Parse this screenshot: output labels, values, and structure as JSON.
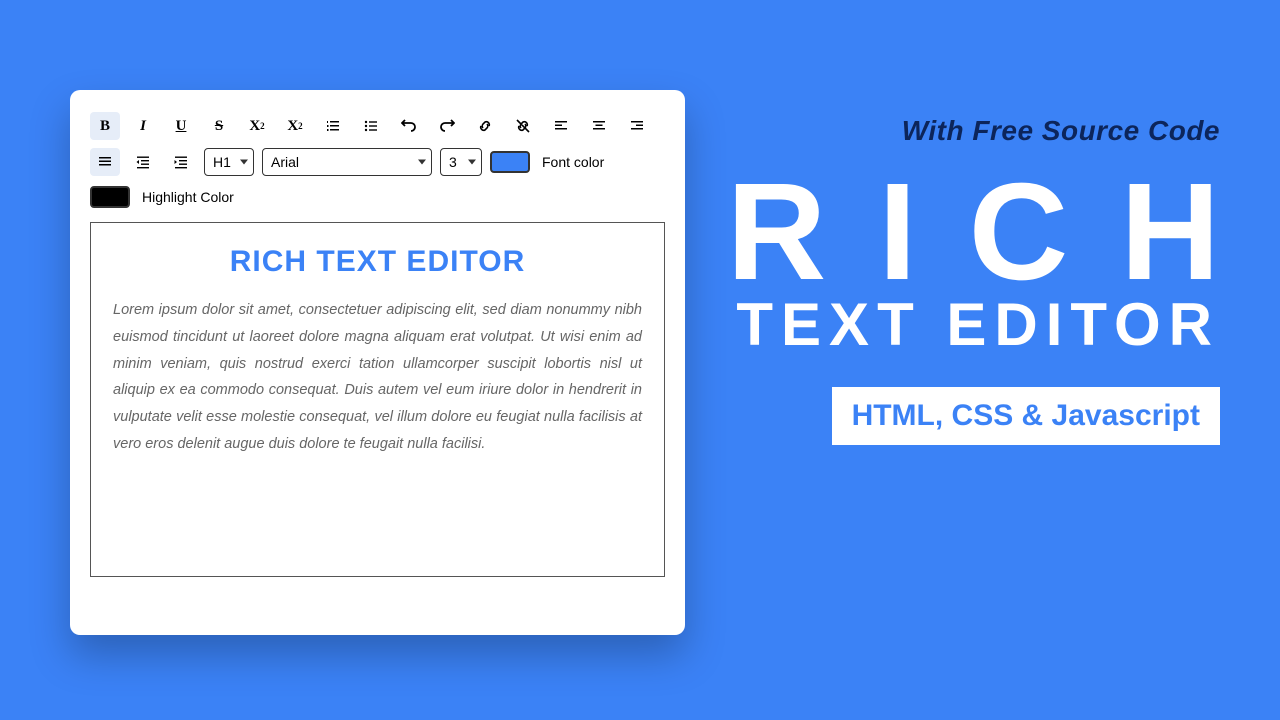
{
  "toolbar": {
    "bold": "B",
    "heading_select": "H1",
    "font_select": "Arial",
    "size_select": "3",
    "font_color_label": "Font color",
    "highlight_color_label": "Highlight Color",
    "font_color_value": "#3b82f6",
    "highlight_color_value": "#000000"
  },
  "content": {
    "title": "RICH TEXT EDITOR",
    "body": "Lorem ipsum dolor sit amet, consectetuer adipiscing elit, sed diam nonummy nibh euismod tincidunt ut laoreet dolore magna aliquam erat volutpat. Ut wisi enim ad minim veniam, quis nostrud exerci tation ullamcorper suscipit lobortis nisl ut aliquip ex ea commodo consequat. Duis autem vel eum iriure dolor in hendrerit in vulputate velit esse molestie consequat, vel illum dolore eu feugiat nulla facilisis at vero eros delenit augue duis dolore te feugait nulla facilisi."
  },
  "promo": {
    "tagline": "With Free Source Code",
    "big1": "RICH",
    "big2": "TEXT EDITOR",
    "badge": "HTML, CSS & Javascript"
  }
}
